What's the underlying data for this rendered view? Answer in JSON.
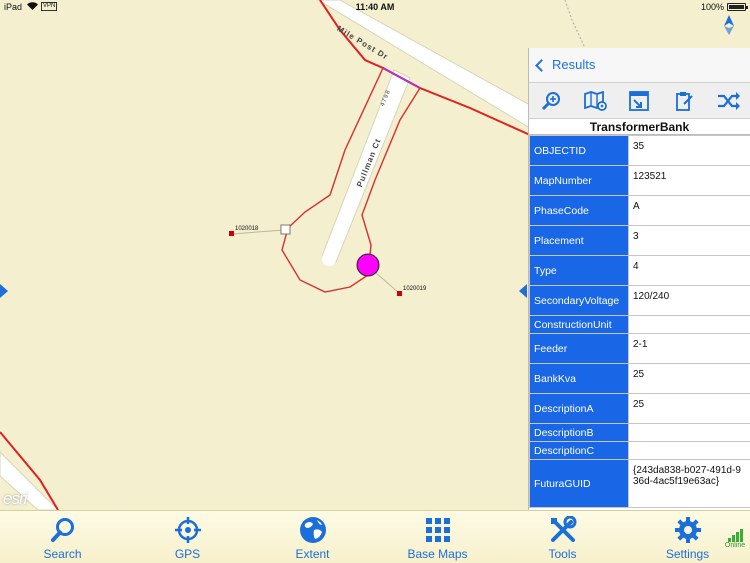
{
  "status_bar": {
    "carrier": "iPad",
    "vpn": "VPN",
    "time": "11:40 AM",
    "battery_percent": "100%",
    "battery_level": 1.0
  },
  "map": {
    "road_labels": {
      "mile_post": "Mile Post Dr",
      "pullman": "Pullman Ct",
      "address": "4798"
    },
    "point_labels": [
      "1020018",
      "1020019"
    ],
    "attribution": "esri",
    "colors": {
      "background": "#f4efcf",
      "road": "#ffffff",
      "primary_line": "#e02020",
      "secondary_line": "#d83030",
      "selected_feature": "#ff00ff",
      "transformer": "#cc0000"
    }
  },
  "panel": {
    "back_label": "Results",
    "tools": [
      {
        "name": "zoom-to-icon"
      },
      {
        "name": "map-locate-icon"
      },
      {
        "name": "export-icon"
      },
      {
        "name": "clipboard-icon"
      },
      {
        "name": "shuffle-icon"
      }
    ],
    "layer_name": "TransformerBank",
    "attributes": [
      {
        "key": "OBJECTID",
        "value": "35"
      },
      {
        "key": "MapNumber",
        "value": "123521"
      },
      {
        "key": "PhaseCode",
        "value": "A"
      },
      {
        "key": "Placement",
        "value": "3"
      },
      {
        "key": "Type",
        "value": "4"
      },
      {
        "key": "SecondaryVoltage",
        "value": "120/240"
      },
      {
        "key": "ConstructionUnit",
        "value": ""
      },
      {
        "key": "Feeder",
        "value": "2-1"
      },
      {
        "key": "BankKva",
        "value": "25"
      },
      {
        "key": "DescriptionA",
        "value": "25"
      },
      {
        "key": "DescriptionB",
        "value": ""
      },
      {
        "key": "DescriptionC",
        "value": ""
      },
      {
        "key": "FuturaGUID",
        "value": "{243da838-b027-491d-936d-4ac5f19e63ac}"
      }
    ]
  },
  "tabbar": {
    "tabs": [
      {
        "label": "Search",
        "icon": "search-icon"
      },
      {
        "label": "GPS",
        "icon": "crosshair-icon"
      },
      {
        "label": "Extent",
        "icon": "globe-icon"
      },
      {
        "label": "Base Maps",
        "icon": "grid-icon"
      },
      {
        "label": "Tools",
        "icon": "tools-icon"
      },
      {
        "label": "Settings",
        "icon": "gear-icon"
      }
    ],
    "connection_status": "Online",
    "accent": "#1a6fd8"
  }
}
